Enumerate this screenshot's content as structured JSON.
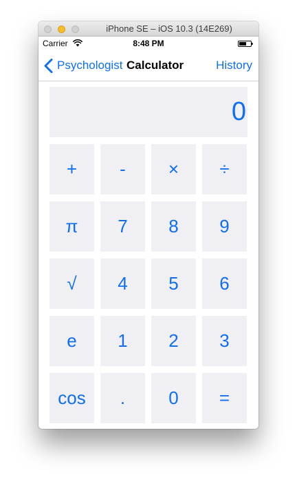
{
  "window": {
    "title": "iPhone SE – iOS 10.3 (14E269)"
  },
  "status_bar": {
    "carrier": "Carrier",
    "time": "8:48 PM"
  },
  "nav_bar": {
    "back_label": "Psychologist",
    "title": "Calculator",
    "right_label": "History"
  },
  "display": {
    "value": "0"
  },
  "keypad": {
    "keys": [
      "+",
      "-",
      "×",
      "÷",
      "π",
      "7",
      "8",
      "9",
      "√",
      "4",
      "5",
      "6",
      "e",
      "1",
      "2",
      "3",
      "cos",
      ".",
      "0",
      "="
    ]
  },
  "colors": {
    "tint": "#0f6ff0",
    "key_background": "#efeff4",
    "window_background": "#ffffff"
  }
}
